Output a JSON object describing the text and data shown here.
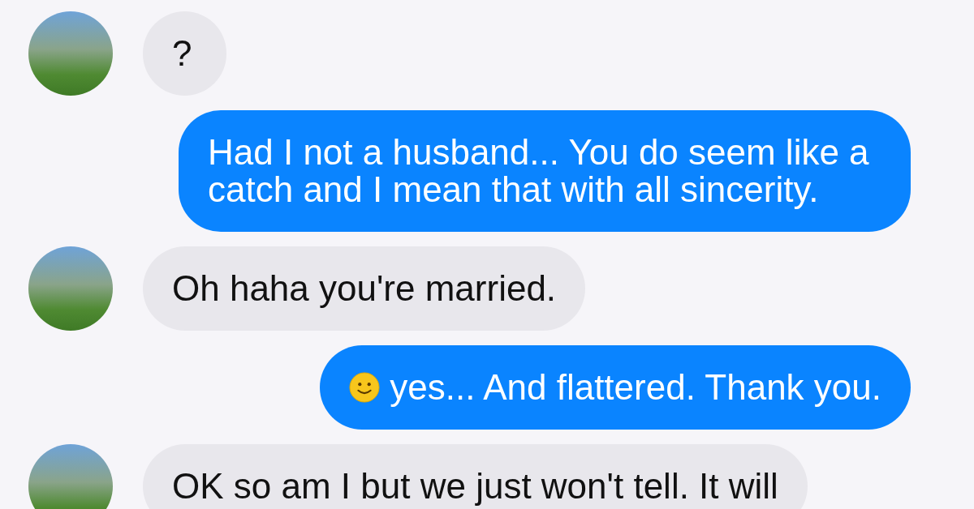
{
  "messages": [
    {
      "kind": "incoming",
      "text": "?",
      "emoji": false
    },
    {
      "kind": "outgoing",
      "text": "Had I not a husband... You do seem like a catch and I mean that with all sincerity.",
      "emoji": false
    },
    {
      "kind": "incoming",
      "text": "Oh haha you're married.",
      "emoji": false
    },
    {
      "kind": "outgoing",
      "text": "yes... And flattered. Thank you.",
      "emoji": true
    },
    {
      "kind": "incoming",
      "text": "OK so am I but we just won't tell. It will",
      "emoji": false
    }
  ]
}
